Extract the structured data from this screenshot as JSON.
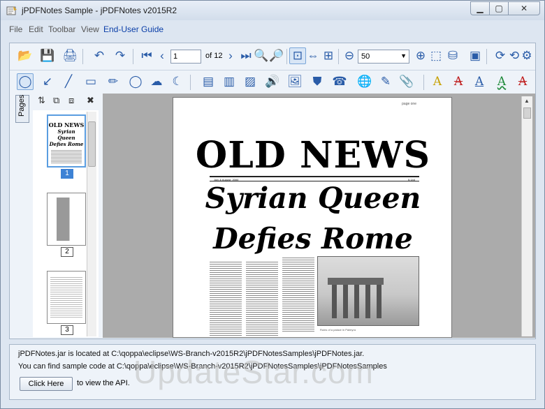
{
  "window": {
    "title": "jPDFNotes Sample - jPDFNotes v2015R2",
    "min_glyph": "▁",
    "max_glyph": "▢",
    "close_glyph": "✕"
  },
  "menu": {
    "items": [
      "File",
      "Edit",
      "Toolbar",
      "View",
      "End-User Guide"
    ]
  },
  "toolbar": {
    "current_page": "1",
    "page_count": "of 12",
    "zoom": "50",
    "row1_icons": [
      {
        "name": "open-icon",
        "glyph": "📂"
      },
      {
        "name": "save-icon",
        "glyph": "💾"
      },
      {
        "name": "print-icon",
        "glyph": "🖨"
      },
      {
        "name": "undo-icon",
        "glyph": "↶"
      },
      {
        "name": "redo-icon",
        "glyph": "↷"
      },
      {
        "name": "first-page-icon",
        "glyph": "⏮"
      },
      {
        "name": "prev-page-icon",
        "glyph": "‹"
      },
      {
        "name": "next-page-icon",
        "glyph": "›"
      },
      {
        "name": "last-page-icon",
        "glyph": "⏭"
      },
      {
        "name": "search-icon",
        "glyph": "🔍"
      },
      {
        "name": "search-next-icon",
        "glyph": "🔎"
      },
      {
        "name": "actual-size-icon",
        "glyph": "⊡"
      },
      {
        "name": "fit-width-icon",
        "glyph": "⇔"
      },
      {
        "name": "fit-page-icon",
        "glyph": "⊞"
      },
      {
        "name": "zoom-out-icon",
        "glyph": "⊖"
      },
      {
        "name": "zoom-in-icon",
        "glyph": "⊕"
      },
      {
        "name": "marquee-zoom-icon",
        "glyph": "⬚"
      },
      {
        "name": "stamp-icon",
        "glyph": "⛁"
      },
      {
        "name": "crop-icon",
        "glyph": "▣"
      },
      {
        "name": "rotate-cw-icon",
        "glyph": "⟳"
      },
      {
        "name": "rotate-ccw-icon",
        "glyph": "⟲"
      },
      {
        "name": "settings-icon",
        "glyph": "⚙"
      }
    ],
    "row2_icons": [
      {
        "name": "select-tool-icon",
        "glyph": "◯"
      },
      {
        "name": "arrow-tool-icon",
        "glyph": "↙"
      },
      {
        "name": "line-tool-icon",
        "glyph": "╱"
      },
      {
        "name": "rectangle-tool-icon",
        "glyph": "▭"
      },
      {
        "name": "pencil-tool-icon",
        "glyph": "✏"
      },
      {
        "name": "ellipse-tool-icon",
        "glyph": "◯"
      },
      {
        "name": "cloud-tool-icon",
        "glyph": "☁"
      },
      {
        "name": "arc-tool-icon",
        "glyph": "☾"
      },
      {
        "name": "note-icon",
        "glyph": "▤"
      },
      {
        "name": "text-box-icon",
        "glyph": "▥"
      },
      {
        "name": "sticky-note-icon",
        "glyph": "▨"
      },
      {
        "name": "sound-icon",
        "glyph": "🔊"
      },
      {
        "name": "image-icon",
        "glyph": "🖼"
      },
      {
        "name": "stamp-tool-icon",
        "glyph": "⛊"
      },
      {
        "name": "fax-icon",
        "glyph": "☎"
      },
      {
        "name": "web-icon",
        "glyph": "🌐"
      },
      {
        "name": "edit-icon",
        "glyph": "✎"
      },
      {
        "name": "attach-icon",
        "glyph": "📎"
      },
      {
        "name": "highlight-text-icon",
        "glyph": "A"
      },
      {
        "name": "strikeout-text-icon",
        "glyph": "A"
      },
      {
        "name": "underline-text-icon",
        "glyph": "A"
      },
      {
        "name": "squiggly-text-icon",
        "glyph": "A"
      },
      {
        "name": "strikethrough-red-text-icon",
        "glyph": "A"
      }
    ]
  },
  "sidebar": {
    "tab_label": "Pages",
    "tool_glyphs": [
      "⇅",
      "⧉",
      "⧈",
      "✖"
    ],
    "thumbnails": [
      {
        "number": "1",
        "selected": true
      },
      {
        "number": "2",
        "selected": false
      },
      {
        "number": "3",
        "selected": false
      }
    ],
    "thumb1_lines": [
      "OLD NEWS",
      "Syrian Queen",
      "Defies Rome"
    ]
  },
  "document": {
    "page_header": "page one",
    "masthead": "OLD NEWS",
    "dateline_left": "July & August, 2000",
    "dateline_right": "5.144",
    "headline_line1": "Syrian Queen",
    "headline_line2": "Defies Rome",
    "photo_caption": "Ruins of a palace in Palmyra"
  },
  "info": {
    "line1": "jPDFNotes.jar is located at C:\\qoppa\\eclipse\\WS-Branch-v2015R2\\jPDFNotesSamples\\jPDFNotes.jar.",
    "line2": "You can find sample code at C:\\qoppa\\eclipse\\WS-Branch-v2015R2\\jPDFNotesSamples\\jPDFNotesSamples",
    "button_label": "Click Here",
    "after_button": "to view the API."
  },
  "watermark": "UpdateStar.com",
  "colors": {
    "accent": "#3d82d5",
    "menu_link": "#0a3ea8",
    "window_bg": "#dde6f1"
  }
}
